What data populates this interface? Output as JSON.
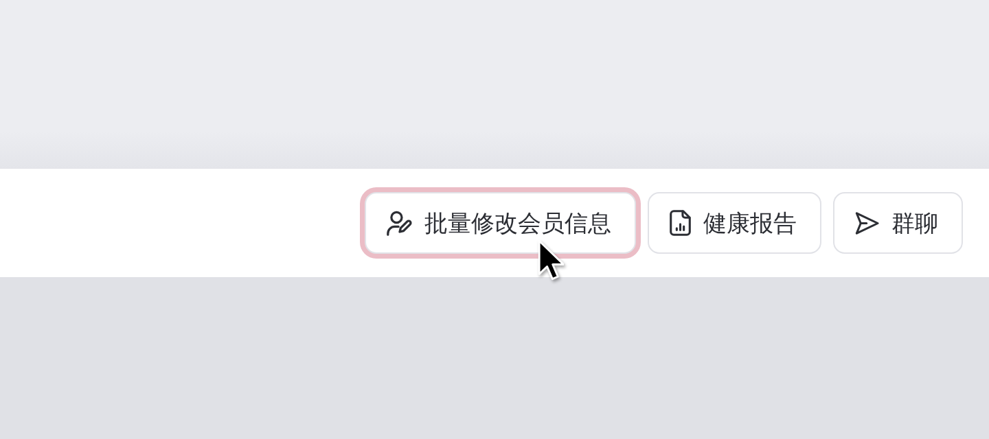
{
  "toolbar": {
    "buttons": [
      {
        "label": "批量修改会员信息",
        "focused": true
      },
      {
        "label": "健康报告",
        "focused": false
      },
      {
        "label": "群聊",
        "focused": false
      }
    ]
  }
}
